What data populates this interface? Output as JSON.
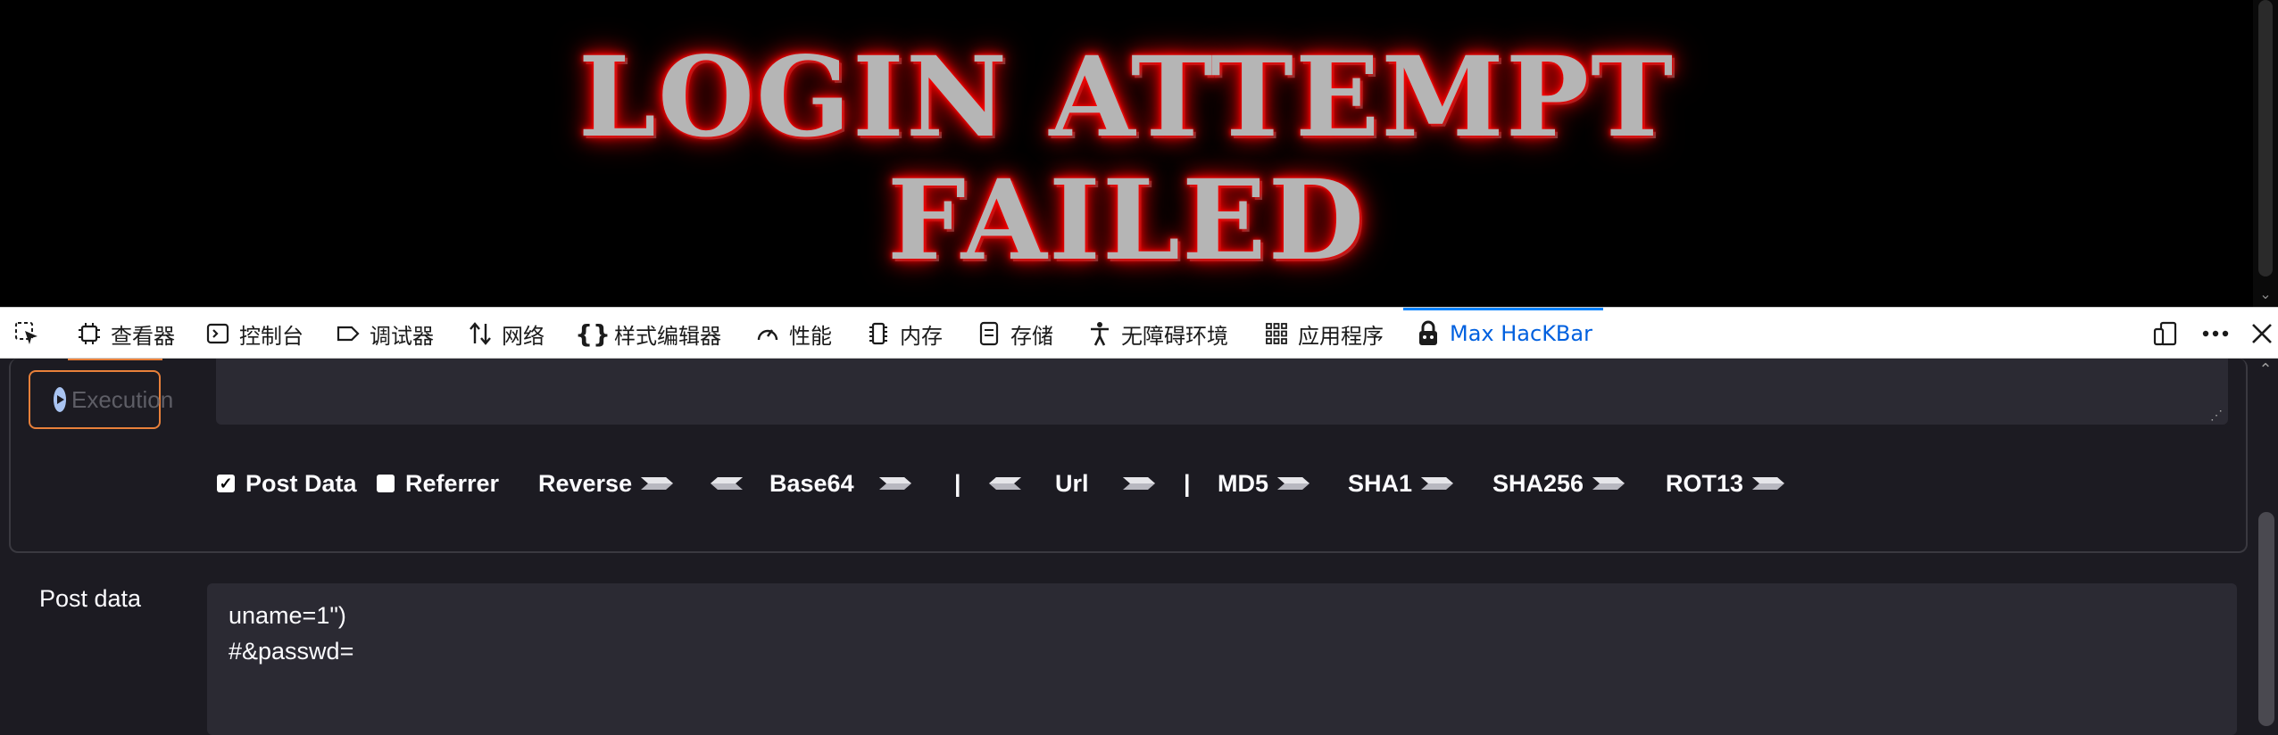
{
  "banner": {
    "line1": "LOGIN ATTEMPT",
    "line2": "FAILED",
    "glow_color": "#ff0000"
  },
  "devtools": {
    "tabs": [
      {
        "label": "查看器",
        "icon": "inspector-icon"
      },
      {
        "label": "控制台",
        "icon": "console-icon"
      },
      {
        "label": "调试器",
        "icon": "debugger-icon"
      },
      {
        "label": "网络",
        "icon": "network-icon"
      },
      {
        "label": "样式编辑器",
        "icon": "style-editor-icon"
      },
      {
        "label": "性能",
        "icon": "performance-icon"
      },
      {
        "label": "内存",
        "icon": "memory-icon"
      },
      {
        "label": "存储",
        "icon": "storage-icon"
      },
      {
        "label": "无障碍环境",
        "icon": "accessibility-icon"
      },
      {
        "label": "应用程序",
        "icon": "application-icon"
      },
      {
        "label": "Max HacKBar",
        "icon": "hackbar-icon",
        "active": true
      }
    ],
    "accent": "#0a84ff"
  },
  "hackbar": {
    "execute_label": "Execution",
    "options": {
      "post_data": {
        "label": "Post Data",
        "checked": true
      },
      "referrer": {
        "label": "Referrer",
        "checked": false
      },
      "reverse": "Reverse",
      "base64": "Base64",
      "separator": "|",
      "url": "Url",
      "md5": "MD5",
      "sha1": "SHA1",
      "sha256": "SHA256",
      "rot13": "ROT13"
    },
    "post_data_label": "Post data",
    "post_data_lines": [
      "uname=1\")",
      "#&passwd="
    ],
    "accent": "#e8803a"
  }
}
